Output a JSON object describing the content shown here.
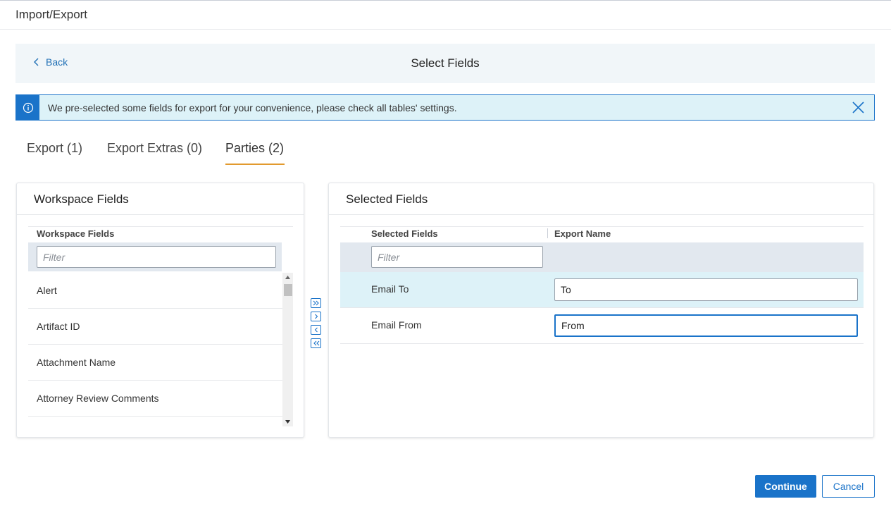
{
  "app": {
    "title": "Import/Export"
  },
  "step": {
    "back_label": "Back",
    "title": "Select Fields"
  },
  "banner": {
    "message": "We pre-selected some fields for export for your convenience, please check all tables' settings.",
    "icon": "info-icon",
    "close_icon": "close-icon"
  },
  "tabs": [
    {
      "label": "Export (1)",
      "active": false
    },
    {
      "label": "Export Extras (0)",
      "active": false
    },
    {
      "label": "Parties (2)",
      "active": true
    }
  ],
  "workspace": {
    "panel_title": "Workspace Fields",
    "column_header": "Workspace Fields",
    "filter_placeholder": "Filter",
    "items": [
      "Alert",
      "Artifact ID",
      "Attachment Name",
      "Attorney Review Comments"
    ]
  },
  "move_buttons": {
    "icons": [
      "double-chevron-right-icon",
      "chevron-right-icon",
      "chevron-left-icon",
      "double-chevron-left-icon"
    ]
  },
  "selected": {
    "panel_title": "Selected Fields",
    "column_field": "Selected Fields",
    "column_export": "Export Name",
    "filter_placeholder": "Filter",
    "rows": [
      {
        "field": "Email To",
        "export_name": "To",
        "highlighted": true
      },
      {
        "field": "Email From",
        "export_name": "From",
        "focused": true
      }
    ]
  },
  "actions": {
    "continue_label": "Continue",
    "cancel_label": "Cancel"
  },
  "colors": {
    "accent": "#1a73c9",
    "tab_underline": "#e29a2e",
    "banner_bg": "#ddf2f8",
    "step_bar_bg": "#f1f6f9"
  }
}
